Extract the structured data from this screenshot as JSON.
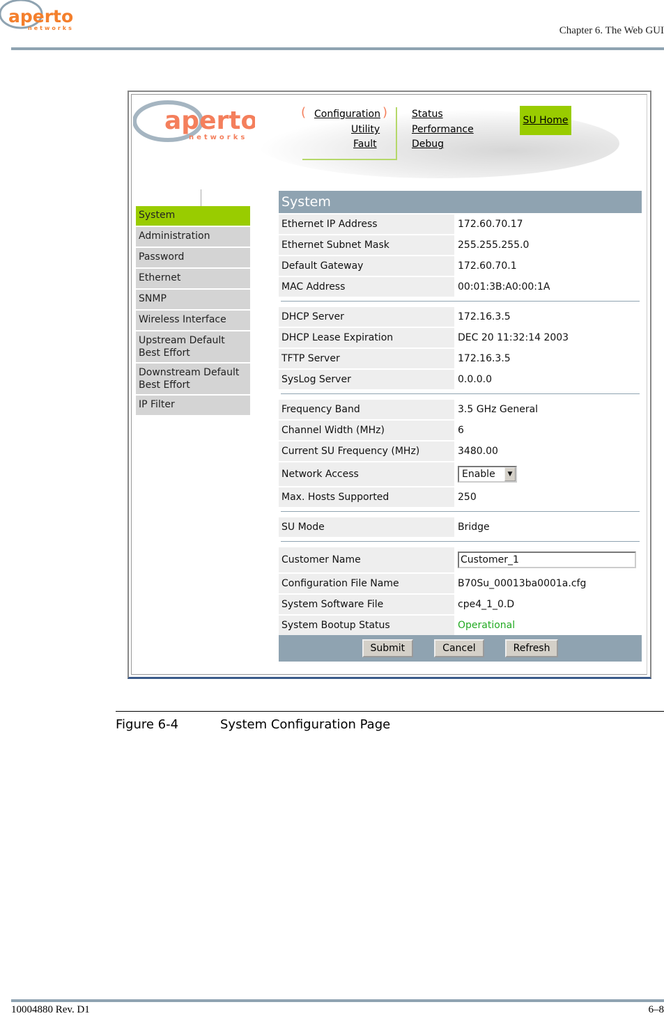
{
  "header": {
    "logo_text": "aperto",
    "logo_sub": "networks",
    "chapter": "Chapter 6.  The Web GUI"
  },
  "screenshot": {
    "logo_text": "aperto",
    "logo_sub": "networks",
    "nav_left": [
      "Configuration",
      "Utility",
      "Fault"
    ],
    "nav_right": [
      "Status",
      "Performance",
      "Debug"
    ],
    "su_home": "SU Home",
    "sidebar": [
      "System",
      "Administration",
      "Password",
      "Ethernet",
      "SNMP",
      "Wireless Interface",
      "Upstream Default Best Effort",
      "Downstream Default Best Effort",
      "IP Filter"
    ],
    "title": "System",
    "groups": [
      [
        {
          "label": "Ethernet IP Address",
          "value": "172.60.70.17"
        },
        {
          "label": "Ethernet Subnet Mask",
          "value": "255.255.255.0"
        },
        {
          "label": "Default Gateway",
          "value": "172.60.70.1"
        },
        {
          "label": "MAC Address",
          "value": "00:01:3B:A0:00:1A"
        }
      ],
      [
        {
          "label": "DHCP Server",
          "value": "172.16.3.5"
        },
        {
          "label": "DHCP Lease Expiration",
          "value": "DEC 20 11:32:14 2003"
        },
        {
          "label": "TFTP Server",
          "value": "172.16.3.5"
        },
        {
          "label": "SysLog Server",
          "value": "0.0.0.0"
        }
      ],
      [
        {
          "label": "Frequency Band",
          "value": "3.5 GHz General"
        },
        {
          "label": "Channel Width (MHz)",
          "value": "6"
        },
        {
          "label": "Current SU Frequency (MHz)",
          "value": "3480.00"
        },
        {
          "label": "Network Access",
          "value": "Enable"
        },
        {
          "label": "Max. Hosts Supported",
          "value": "250"
        }
      ],
      [
        {
          "label": "SU Mode",
          "value": "Bridge"
        }
      ],
      [
        {
          "label": "Customer Name",
          "value": "Customer_1"
        },
        {
          "label": "Configuration File Name",
          "value": "B70Su_00013ba0001a.cfg"
        },
        {
          "label": "System Software File",
          "value": "cpe4_1_0.D"
        },
        {
          "label": "System Bootup Status",
          "value": "Operational"
        }
      ]
    ],
    "buttons": {
      "submit": "Submit",
      "cancel": "Cancel",
      "refresh": "Refresh"
    },
    "colors": {
      "accent": "#99cc00",
      "header_bar": "#8fa3b1",
      "status_ok": "#22aa22"
    }
  },
  "caption": {
    "number": "Figure 6-4",
    "title": "System Configuration Page"
  },
  "footer": {
    "doc": "10004880 Rev. D1",
    "page": "6–8"
  }
}
